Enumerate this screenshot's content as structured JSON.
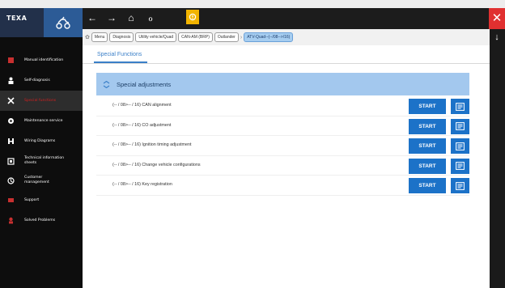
{
  "app": {
    "brand": "TEXA"
  },
  "colors": {
    "accent": "#1c72c8",
    "active_menu_text": "#d02020",
    "warning": "#f2b400",
    "close": "#e03030"
  },
  "topbar": {
    "icons": [
      "back-arrow-icon",
      "forward-arrow-icon",
      "home-icon",
      "link-icon",
      "warning-icon"
    ],
    "back_glyph": "←",
    "forward_glyph": "→",
    "home_glyph": "⌂",
    "link_glyph": "ℴ",
    "close_glyph": "✕",
    "down_glyph": "↓"
  },
  "breadcrumb": [
    "Menu",
    "Diagnosis",
    "Utility vehicle/Quad",
    "CAN-AM (BRP)",
    "Outlander",
    "ATV-Quad--(--/08-->/16)"
  ],
  "sidebar": {
    "items": [
      {
        "label": "Manual identification",
        "icon": "manual-identification-icon",
        "active": false
      },
      {
        "label": "Self-diagnosis",
        "icon": "person-icon",
        "active": false
      },
      {
        "label": "Special functions",
        "icon": "special-functions-icon",
        "active": true
      },
      {
        "label": "Maintenance service",
        "icon": "gear-icon",
        "active": false
      },
      {
        "label": "Wiring Diagrams",
        "icon": "wiring-icon",
        "active": false
      },
      {
        "label": "Technical information sheets",
        "icon": "info-sheet-icon",
        "active": false
      },
      {
        "label": "Customer management",
        "icon": "customer-icon",
        "active": false
      },
      {
        "label": "Support",
        "icon": "support-icon",
        "active": false
      },
      {
        "label": "Solved Problems",
        "icon": "solved-problems-icon",
        "active": false
      }
    ]
  },
  "main": {
    "tab_label": "Special Functions",
    "section_title": "Special adjustments",
    "start_label": "START",
    "rows": [
      {
        "text": "(-- / 08>-- / 16)  CAN alignment"
      },
      {
        "text": "(-- / 08>-- / 16)  CO adjustment"
      },
      {
        "text": "(-- / 08>-- / 16)  Ignition timing adjustment"
      },
      {
        "text": "(-- / 08>-- / 16)  Change vehicle configurations"
      },
      {
        "text": "(-- / 08>-- / 16)  Key registration"
      }
    ]
  }
}
